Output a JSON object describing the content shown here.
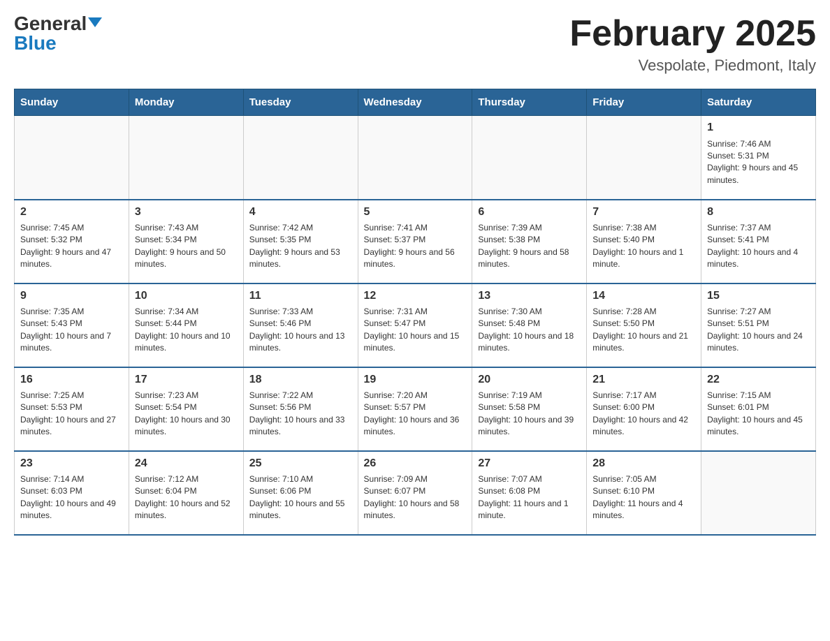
{
  "logo": {
    "text_black": "General",
    "text_blue": "Blue"
  },
  "header": {
    "title": "February 2025",
    "subtitle": "Vespolate, Piedmont, Italy"
  },
  "days_of_week": [
    "Sunday",
    "Monday",
    "Tuesday",
    "Wednesday",
    "Thursday",
    "Friday",
    "Saturday"
  ],
  "weeks": [
    [
      {
        "day": "",
        "info": ""
      },
      {
        "day": "",
        "info": ""
      },
      {
        "day": "",
        "info": ""
      },
      {
        "day": "",
        "info": ""
      },
      {
        "day": "",
        "info": ""
      },
      {
        "day": "",
        "info": ""
      },
      {
        "day": "1",
        "info": "Sunrise: 7:46 AM\nSunset: 5:31 PM\nDaylight: 9 hours and 45 minutes."
      }
    ],
    [
      {
        "day": "2",
        "info": "Sunrise: 7:45 AM\nSunset: 5:32 PM\nDaylight: 9 hours and 47 minutes."
      },
      {
        "day": "3",
        "info": "Sunrise: 7:43 AM\nSunset: 5:34 PM\nDaylight: 9 hours and 50 minutes."
      },
      {
        "day": "4",
        "info": "Sunrise: 7:42 AM\nSunset: 5:35 PM\nDaylight: 9 hours and 53 minutes."
      },
      {
        "day": "5",
        "info": "Sunrise: 7:41 AM\nSunset: 5:37 PM\nDaylight: 9 hours and 56 minutes."
      },
      {
        "day": "6",
        "info": "Sunrise: 7:39 AM\nSunset: 5:38 PM\nDaylight: 9 hours and 58 minutes."
      },
      {
        "day": "7",
        "info": "Sunrise: 7:38 AM\nSunset: 5:40 PM\nDaylight: 10 hours and 1 minute."
      },
      {
        "day": "8",
        "info": "Sunrise: 7:37 AM\nSunset: 5:41 PM\nDaylight: 10 hours and 4 minutes."
      }
    ],
    [
      {
        "day": "9",
        "info": "Sunrise: 7:35 AM\nSunset: 5:43 PM\nDaylight: 10 hours and 7 minutes."
      },
      {
        "day": "10",
        "info": "Sunrise: 7:34 AM\nSunset: 5:44 PM\nDaylight: 10 hours and 10 minutes."
      },
      {
        "day": "11",
        "info": "Sunrise: 7:33 AM\nSunset: 5:46 PM\nDaylight: 10 hours and 13 minutes."
      },
      {
        "day": "12",
        "info": "Sunrise: 7:31 AM\nSunset: 5:47 PM\nDaylight: 10 hours and 15 minutes."
      },
      {
        "day": "13",
        "info": "Sunrise: 7:30 AM\nSunset: 5:48 PM\nDaylight: 10 hours and 18 minutes."
      },
      {
        "day": "14",
        "info": "Sunrise: 7:28 AM\nSunset: 5:50 PM\nDaylight: 10 hours and 21 minutes."
      },
      {
        "day": "15",
        "info": "Sunrise: 7:27 AM\nSunset: 5:51 PM\nDaylight: 10 hours and 24 minutes."
      }
    ],
    [
      {
        "day": "16",
        "info": "Sunrise: 7:25 AM\nSunset: 5:53 PM\nDaylight: 10 hours and 27 minutes."
      },
      {
        "day": "17",
        "info": "Sunrise: 7:23 AM\nSunset: 5:54 PM\nDaylight: 10 hours and 30 minutes."
      },
      {
        "day": "18",
        "info": "Sunrise: 7:22 AM\nSunset: 5:56 PM\nDaylight: 10 hours and 33 minutes."
      },
      {
        "day": "19",
        "info": "Sunrise: 7:20 AM\nSunset: 5:57 PM\nDaylight: 10 hours and 36 minutes."
      },
      {
        "day": "20",
        "info": "Sunrise: 7:19 AM\nSunset: 5:58 PM\nDaylight: 10 hours and 39 minutes."
      },
      {
        "day": "21",
        "info": "Sunrise: 7:17 AM\nSunset: 6:00 PM\nDaylight: 10 hours and 42 minutes."
      },
      {
        "day": "22",
        "info": "Sunrise: 7:15 AM\nSunset: 6:01 PM\nDaylight: 10 hours and 45 minutes."
      }
    ],
    [
      {
        "day": "23",
        "info": "Sunrise: 7:14 AM\nSunset: 6:03 PM\nDaylight: 10 hours and 49 minutes."
      },
      {
        "day": "24",
        "info": "Sunrise: 7:12 AM\nSunset: 6:04 PM\nDaylight: 10 hours and 52 minutes."
      },
      {
        "day": "25",
        "info": "Sunrise: 7:10 AM\nSunset: 6:06 PM\nDaylight: 10 hours and 55 minutes."
      },
      {
        "day": "26",
        "info": "Sunrise: 7:09 AM\nSunset: 6:07 PM\nDaylight: 10 hours and 58 minutes."
      },
      {
        "day": "27",
        "info": "Sunrise: 7:07 AM\nSunset: 6:08 PM\nDaylight: 11 hours and 1 minute."
      },
      {
        "day": "28",
        "info": "Sunrise: 7:05 AM\nSunset: 6:10 PM\nDaylight: 11 hours and 4 minutes."
      },
      {
        "day": "",
        "info": ""
      }
    ]
  ]
}
